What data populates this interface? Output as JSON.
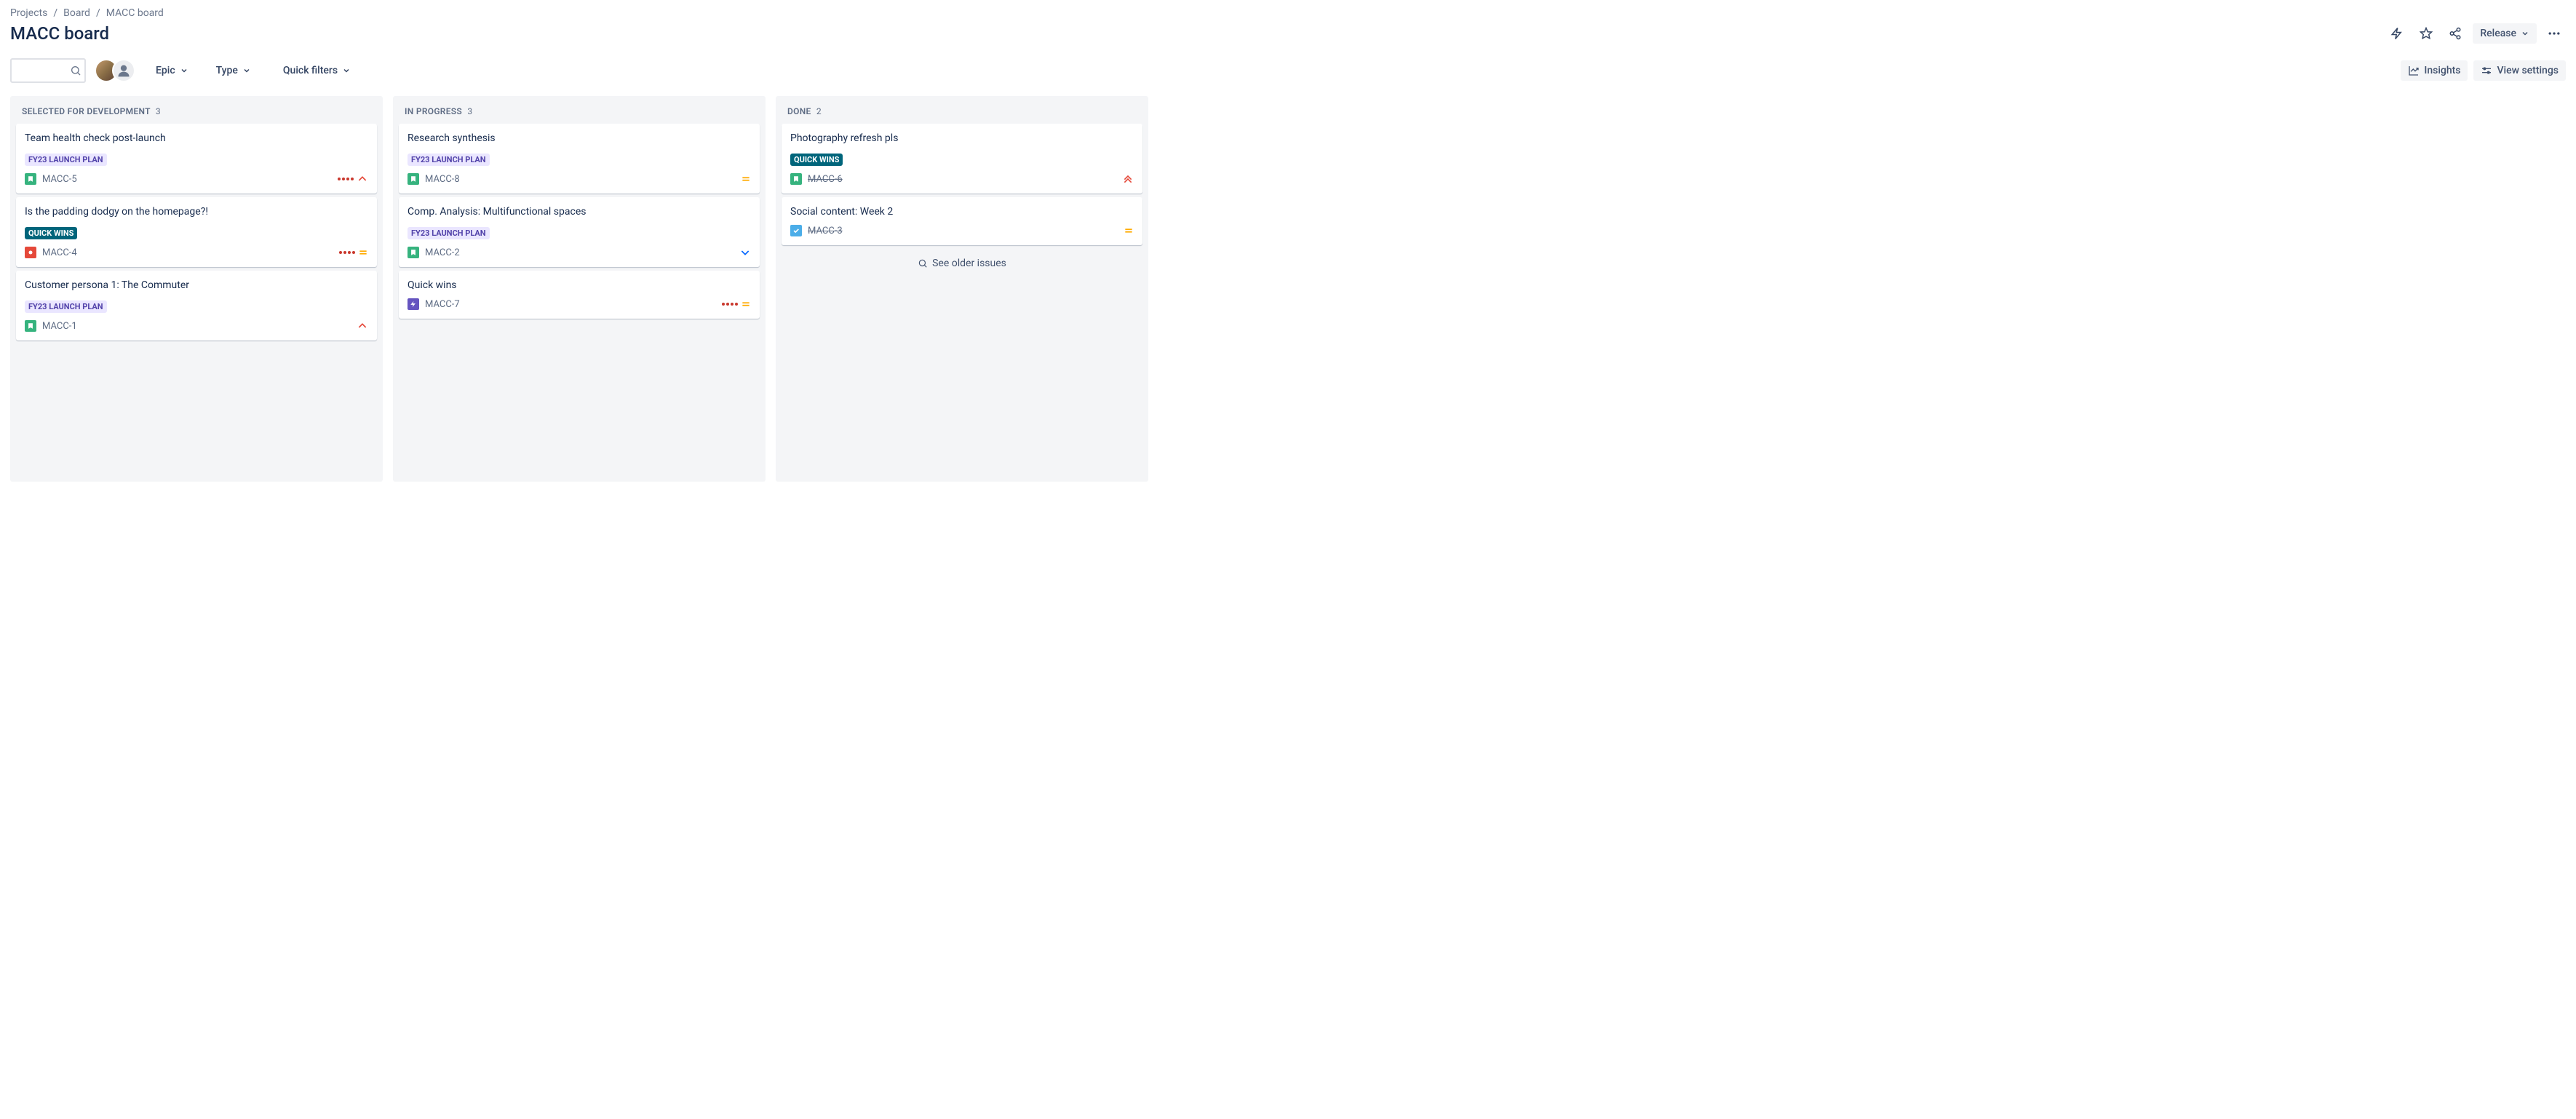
{
  "breadcrumb": {
    "a": "Projects",
    "b": "Board",
    "c": "MACC board"
  },
  "title": "MACC board",
  "header": {
    "release": "Release"
  },
  "filters": {
    "epic": "Epic",
    "type": "Type",
    "quick": "Quick filters"
  },
  "right_buttons": {
    "insights": "Insights",
    "view": "View settings"
  },
  "search_placeholder": "",
  "older": "See older issues",
  "columns": [
    {
      "name": "SELECTED FOR DEVELOPMENT",
      "count": "3",
      "cards": [
        {
          "title": "Team health check post-launch",
          "badge": "FY23 LAUNCH PLAN",
          "badge_kind": "launch",
          "type": "story",
          "key": "MACC-5",
          "dots4": true,
          "priority": "high",
          "done": false
        },
        {
          "title": "Is the padding dodgy on the homepage?!",
          "badge": "QUICK WINS",
          "badge_kind": "quick",
          "type": "bug",
          "key": "MACC-4",
          "dots4": true,
          "priority": "medium",
          "done": false
        },
        {
          "title": "Customer persona 1: The Commuter",
          "badge": "FY23 LAUNCH PLAN",
          "badge_kind": "launch",
          "type": "story",
          "key": "MACC-1",
          "dots4": false,
          "priority": "high",
          "done": false
        }
      ]
    },
    {
      "name": "IN PROGRESS",
      "count": "3",
      "cards": [
        {
          "title": "Research synthesis",
          "badge": "FY23 LAUNCH PLAN",
          "badge_kind": "launch",
          "type": "story",
          "key": "MACC-8",
          "dots4": false,
          "priority": "medium",
          "done": false
        },
        {
          "title": "Comp. Analysis: Multifunctional spaces",
          "badge": "FY23 LAUNCH PLAN",
          "badge_kind": "launch",
          "type": "story",
          "key": "MACC-2",
          "dots4": false,
          "priority": "low",
          "done": false
        },
        {
          "title": "Quick wins",
          "badge": "",
          "badge_kind": "",
          "type": "epic",
          "key": "MACC-7",
          "dots4": true,
          "priority": "medium",
          "done": false
        }
      ]
    },
    {
      "name": "DONE",
      "count": "2",
      "older": true,
      "cards": [
        {
          "title": "Photography refresh pls",
          "badge": "QUICK WINS",
          "badge_kind": "quick",
          "type": "story",
          "key": "MACC-6",
          "dots4": false,
          "priority": "highest",
          "done": true
        },
        {
          "title": "Social content: Week 2",
          "badge": "",
          "badge_kind": "",
          "type": "task",
          "key": "MACC-3",
          "dots4": false,
          "priority": "medium",
          "done": true
        }
      ]
    }
  ]
}
